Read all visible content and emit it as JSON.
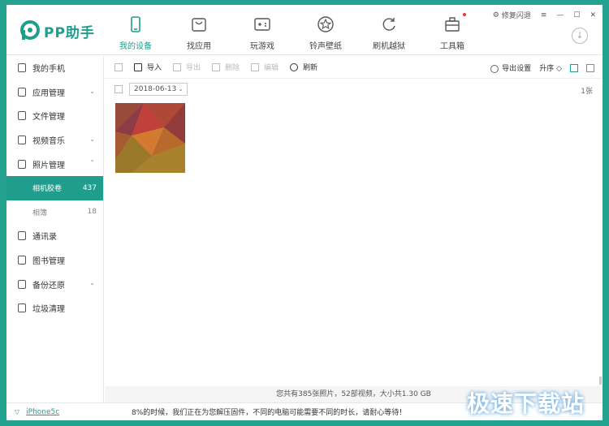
{
  "app": {
    "name": "PP助手",
    "brand_color": "#1f9e8d",
    "frame_color": "#23a38f"
  },
  "nav": [
    {
      "label": "我的设备",
      "icon": "phone-icon",
      "active": true
    },
    {
      "label": "找应用",
      "icon": "bag-icon",
      "active": false
    },
    {
      "label": "玩游戏",
      "icon": "gamepad-icon",
      "active": false
    },
    {
      "label": "铃声壁纸",
      "icon": "star-icon",
      "active": false
    },
    {
      "label": "刷机越狱",
      "icon": "refresh-icon",
      "active": false
    },
    {
      "label": "工具箱",
      "icon": "toolbox-icon",
      "active": false,
      "badge": true
    }
  ],
  "window_controls": {
    "repair_label": "修复闪退",
    "menu": "≡",
    "minimize": "—",
    "maximize": "☐",
    "close": "✕"
  },
  "sidebar": {
    "items": [
      {
        "label": "我的手机",
        "icon": "phone-icon"
      },
      {
        "label": "应用管理",
        "icon": "app-icon",
        "chevron": "⌄"
      },
      {
        "label": "文件管理",
        "icon": "folder-icon"
      },
      {
        "label": "视频音乐",
        "icon": "video-icon",
        "chevron": "⌄"
      },
      {
        "label": "照片管理",
        "icon": "photo-icon",
        "chevron": "⌃"
      }
    ],
    "photo_sub": [
      {
        "label": "相机胶卷",
        "count": "437",
        "active": true
      },
      {
        "label": "相簿",
        "count": "18",
        "active": false
      }
    ],
    "items_after": [
      {
        "label": "通讯录",
        "icon": "contacts-icon"
      },
      {
        "label": "图书管理",
        "icon": "book-icon"
      },
      {
        "label": "备份还原",
        "icon": "backup-icon",
        "chevron": "⌄"
      },
      {
        "label": "垃圾清理",
        "icon": "trash-icon"
      }
    ]
  },
  "toolbar": {
    "import": "导入",
    "export": "导出",
    "delete": "删除",
    "edit": "编辑",
    "refresh": "刷新",
    "export_settings": "导出设置",
    "sort": "升序"
  },
  "group": {
    "date": "2018-06-13",
    "count": "1张"
  },
  "statusline": "您共有385张照片，52部视频，大小共1.30 GB",
  "bottom": {
    "device": "iPhone5c",
    "notice": "8%的时候，我们正在为您解压固件，不同的电脑可能需要不同的时长，请耐心等待！"
  },
  "watermark": "极速下载站"
}
